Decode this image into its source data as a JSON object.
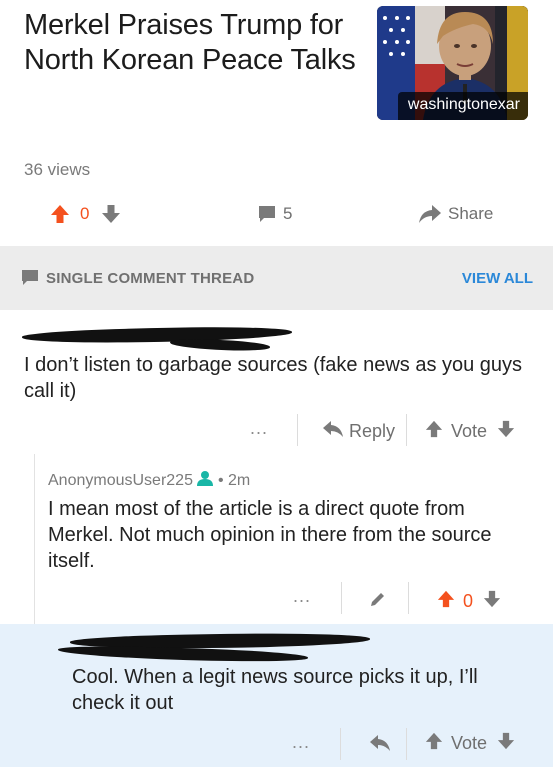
{
  "article": {
    "title": "Merkel Praises Trump for North Korean Peace Talks",
    "source": "washingtonexar",
    "views": "36 views"
  },
  "actions": {
    "votes": "0",
    "comments": "5",
    "share": "Share"
  },
  "thread": {
    "label": "SINGLE COMMENT THREAD",
    "view_all": "VIEW ALL"
  },
  "comments": [
    {
      "text": "I don’t listen to garbage sources (fake news as you guys call it)",
      "more": "...",
      "reply": "Reply",
      "vote": "Vote"
    },
    {
      "username": "AnonymousUser225",
      "time": "• 2m",
      "text": "I mean most of the article is a direct quote from Merkel. Not much opinion in there from the source itself.",
      "more": "...",
      "votes": "0"
    },
    {
      "text": "Cool. When a legit news source picks it up, I’ll check it out",
      "more": "...",
      "vote": "Vote"
    }
  ],
  "colors": {
    "upvote": "#f4511e",
    "link": "#2b88d8",
    "user_icon": "#19b6a6",
    "highlight": "#e6f1fb"
  }
}
